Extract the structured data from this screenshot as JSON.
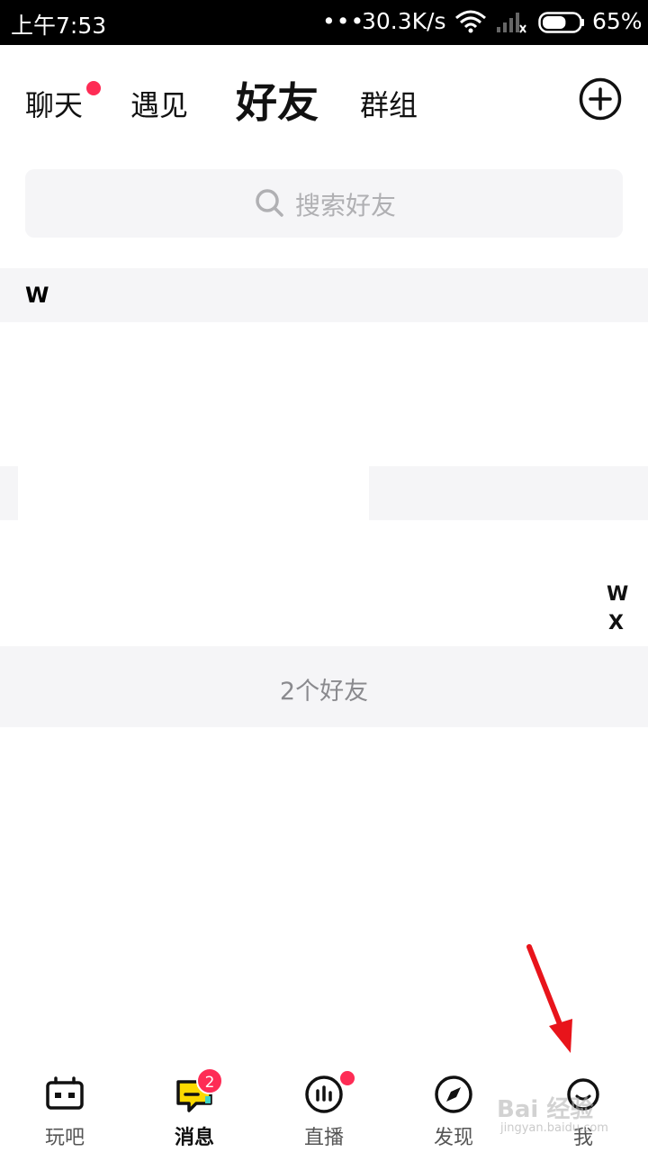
{
  "status_bar": {
    "time": "上午7:53",
    "dots": "•••",
    "net_speed": "30.3K/s",
    "battery_pct": "65%",
    "battery_level": 0.65
  },
  "tabs": {
    "chat": "聊天",
    "meet": "遇见",
    "friends": "好友",
    "groups": "群组"
  },
  "search": {
    "placeholder": "搜索好友"
  },
  "section": {
    "letter": "W"
  },
  "alpha_index": [
    "W",
    "X"
  ],
  "friend_count": "2个好友",
  "bottom_nav": [
    {
      "label": "玩吧",
      "icon": "gamepad-icon"
    },
    {
      "label": "消息",
      "icon": "message-icon",
      "badge": "2"
    },
    {
      "label": "直播",
      "icon": "live-icon"
    },
    {
      "label": "发现",
      "icon": "compass-icon"
    },
    {
      "label": "我",
      "icon": "face-icon"
    }
  ],
  "watermark": {
    "main": "Bai 经验",
    "sub": "jingyan.baidu.com"
  },
  "colors": {
    "accent": "#fe2c55",
    "bg_gray": "#f5f5f7",
    "arrow": "#e8141b"
  }
}
